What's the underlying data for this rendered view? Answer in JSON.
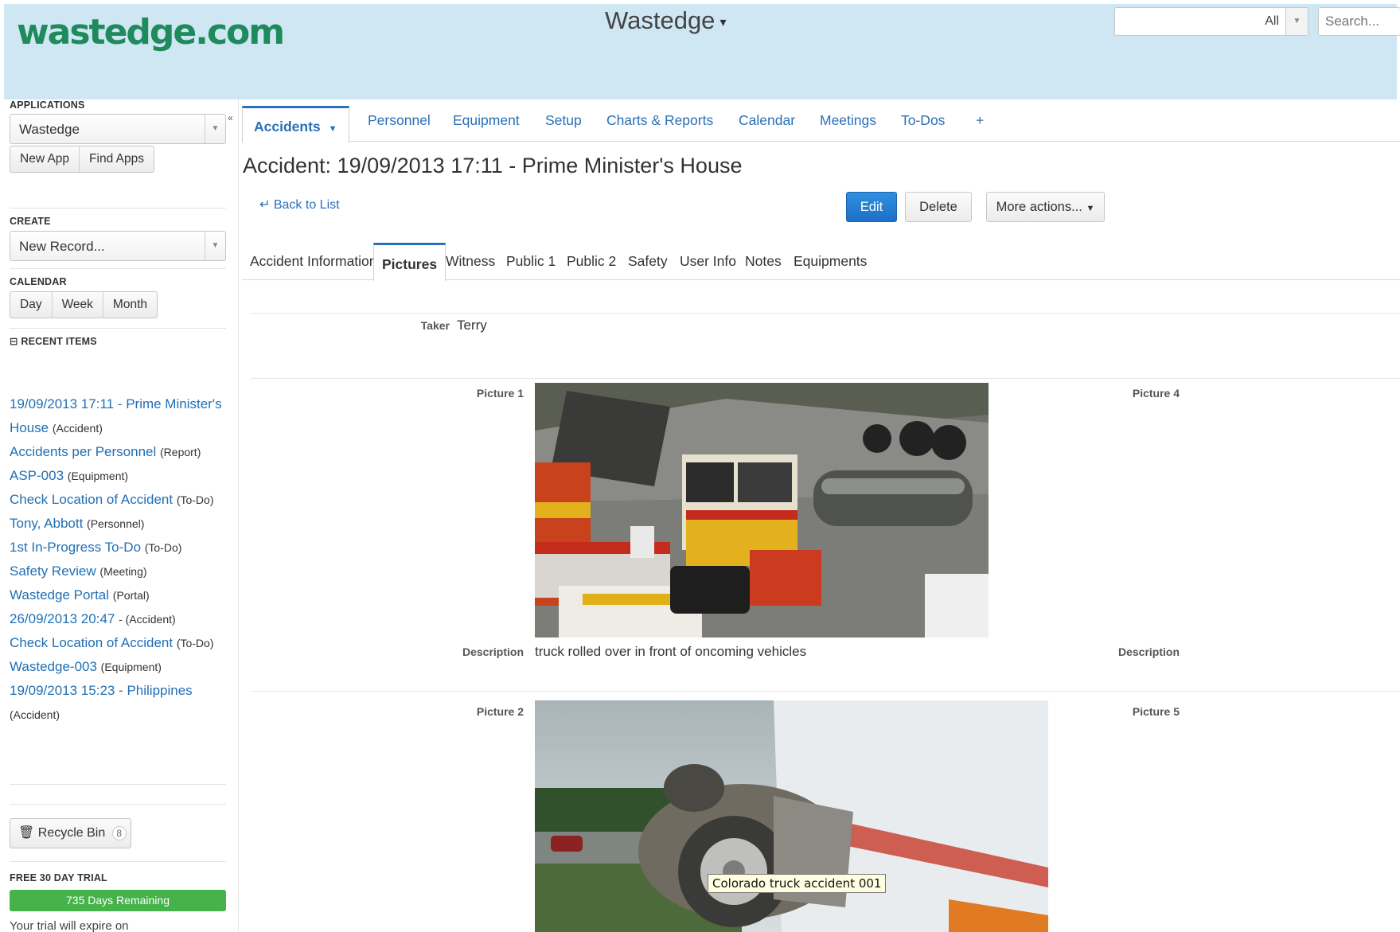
{
  "header": {
    "logo_text": "wastedge.com",
    "app_switcher": "Wastedge",
    "search_scope": "All",
    "search_placeholder": "Search..."
  },
  "sidebar": {
    "applications_label": "APPLICATIONS",
    "application_selected": "Wastedge",
    "new_app": "New App",
    "find_apps": "Find Apps",
    "create_label": "CREATE",
    "create_selected": "New Record...",
    "calendar_label": "CALENDAR",
    "calendar_day": "Day",
    "calendar_week": "Week",
    "calendar_month": "Month",
    "recent_label": "RECENT ITEMS",
    "recent_items": [
      {
        "link": "19/09/2013 17:11 - Prime Minister's House",
        "type": "(Accident)"
      },
      {
        "link": "Accidents per Personnel",
        "type": "(Report)"
      },
      {
        "link": "ASP-003",
        "type": "(Equipment)"
      },
      {
        "link": "Check Location of Accident",
        "type": "(To-Do)"
      },
      {
        "link": "Tony, Abbott",
        "type": "(Personnel)"
      },
      {
        "link": "1st In-Progress To-Do",
        "type": "(To-Do)"
      },
      {
        "link": "Safety Review",
        "type": "(Meeting)"
      },
      {
        "link": "Wastedge Portal",
        "type": "(Portal)"
      },
      {
        "link": "26/09/2013 20:47",
        "type": "- (Accident)"
      },
      {
        "link": "Check Location of Accident",
        "type": "(To-Do)"
      },
      {
        "link": "Wastedge-003",
        "type": "(Equipment)"
      },
      {
        "link": "19/09/2013 15:23 - Philippines",
        "type": "(Accident)"
      }
    ],
    "recycle_bin": "Recycle Bin",
    "recycle_count": "8",
    "trial_label": "FREE 30 DAY TRIAL",
    "trial_remaining": "735 Days Remaining",
    "trial_note": "Your trial will expire on"
  },
  "tabs": {
    "accidents": "Accidents",
    "personnel": "Personnel",
    "equipment": "Equipment",
    "setup": "Setup",
    "charts_reports": "Charts & Reports",
    "calendar": "Calendar",
    "meetings": "Meetings",
    "todos": "To-Dos",
    "add": "+"
  },
  "record": {
    "title": "Accident: 19/09/2013 17:11 - Prime Minister's House",
    "back_to_list": "Back to List",
    "edit": "Edit",
    "delete": "Delete",
    "more_actions": "More actions..."
  },
  "subtabs": {
    "accident_information": "Accident Information",
    "pictures": "Pictures",
    "witness": "Witness",
    "public1": "Public 1",
    "public2": "Public 2",
    "safety": "Safety",
    "user_info": "User Info",
    "notes": "Notes",
    "equipments": "Equipments"
  },
  "fields": {
    "taker_label": "Taker",
    "taker_value": "Terry",
    "picture1_label": "Picture 1",
    "picture4_label": "Picture 4",
    "description_label": "Description",
    "description1_value": "truck rolled over in front of oncoming vehicles",
    "description4_label": "Description",
    "picture2_label": "Picture 2",
    "picture5_label": "Picture 5",
    "tooltip": "Colorado truck accident 001"
  },
  "colors": {
    "header_bg": "#cfe6f3",
    "link_blue": "#2a6fb8",
    "edit_blue": "#1e6fc6",
    "trial_green": "#46b24a",
    "logo_green": "#1f8a5c"
  }
}
